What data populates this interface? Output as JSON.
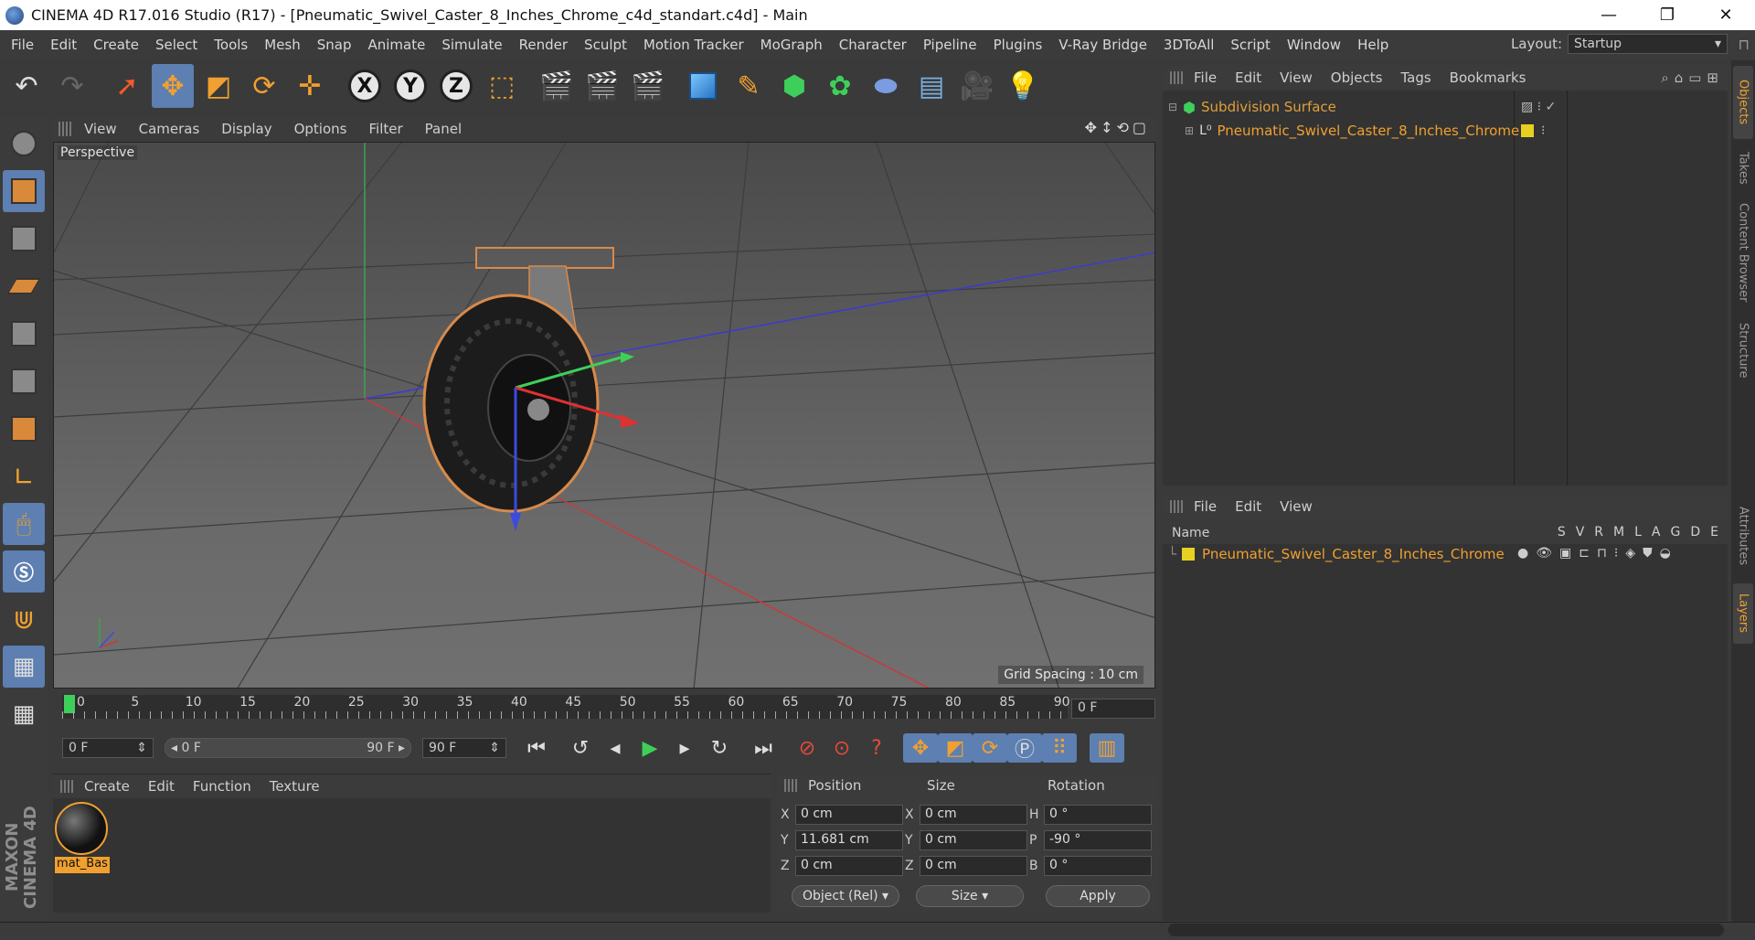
{
  "window": {
    "title": "CINEMA 4D R17.016 Studio (R17) - [Pneumatic_Swivel_Caster_8_Inches_Chrome_c4d_standart.c4d] - Main",
    "minimize": "—",
    "restore": "❐",
    "close": "✕"
  },
  "menubar": {
    "items": [
      "File",
      "Edit",
      "Create",
      "Select",
      "Tools",
      "Mesh",
      "Snap",
      "Animate",
      "Simulate",
      "Render",
      "Sculpt",
      "Motion Tracker",
      "MoGraph",
      "Character",
      "Pipeline",
      "Plugins",
      "V-Ray Bridge",
      "3DToAll",
      "Script",
      "Window",
      "Help"
    ],
    "layout_label": "Layout:",
    "layout_value": "Startup"
  },
  "toolbar": {
    "axis_x": "X",
    "axis_y": "Y",
    "axis_z": "Z"
  },
  "viewport": {
    "menu": [
      "View",
      "Cameras",
      "Display",
      "Options",
      "Filter",
      "Panel"
    ],
    "view_label": "Perspective",
    "grid_spacing": "Grid Spacing : 10 cm",
    "controls": "✥↕⟲▢"
  },
  "timeline": {
    "ticks": [
      "0",
      "5",
      "10",
      "15",
      "20",
      "25",
      "30",
      "35",
      "40",
      "45",
      "50",
      "55",
      "60",
      "65",
      "70",
      "75",
      "80",
      "85",
      "90"
    ],
    "current_frame": "0 F"
  },
  "playback": {
    "start_field": "0 F",
    "range_start": "◂ 0 F",
    "range_end": "90 F ▸",
    "end_field": "90 F"
  },
  "material_manager": {
    "menu": [
      "Create",
      "Edit",
      "Function",
      "Texture"
    ],
    "material_name": "mat_Bas"
  },
  "coordinates": {
    "headers": [
      "Position",
      "Size",
      "Rotation"
    ],
    "rows": [
      {
        "pos_axis": "X",
        "pos": "0 cm",
        "size_axis": "X",
        "size": "0 cm",
        "rot_axis": "H",
        "rot": "0 °"
      },
      {
        "pos_axis": "Y",
        "pos": "11.681 cm",
        "size_axis": "Y",
        "size": "0 cm",
        "rot_axis": "P",
        "rot": "-90 °"
      },
      {
        "pos_axis": "Z",
        "pos": "0 cm",
        "size_axis": "Z",
        "size": "0 cm",
        "rot_axis": "B",
        "rot": "0 °"
      }
    ],
    "mode_select": "Object (Rel) ▾",
    "size_select": "Size ▾",
    "apply": "Apply"
  },
  "object_manager": {
    "menu": [
      "File",
      "Edit",
      "View",
      "Objects",
      "Tags",
      "Bookmarks"
    ],
    "objects": [
      {
        "name": "Subdivision Surface"
      },
      {
        "name": "Pneumatic_Swivel_Caster_8_Inches_Chrome"
      }
    ]
  },
  "layer_manager": {
    "menu": [
      "File",
      "Edit",
      "View"
    ],
    "name_header": "Name",
    "columns": [
      "S",
      "V",
      "R",
      "M",
      "L",
      "A",
      "G",
      "D",
      "E"
    ],
    "layers": [
      {
        "name": "Pneumatic_Swivel_Caster_8_Inches_Chrome"
      }
    ]
  },
  "right_tabs": [
    "Objects",
    "Takes",
    "Content Browser",
    "Structure",
    "Attributes",
    "Layers"
  ],
  "brand": "MAXON CINEMA 4D"
}
